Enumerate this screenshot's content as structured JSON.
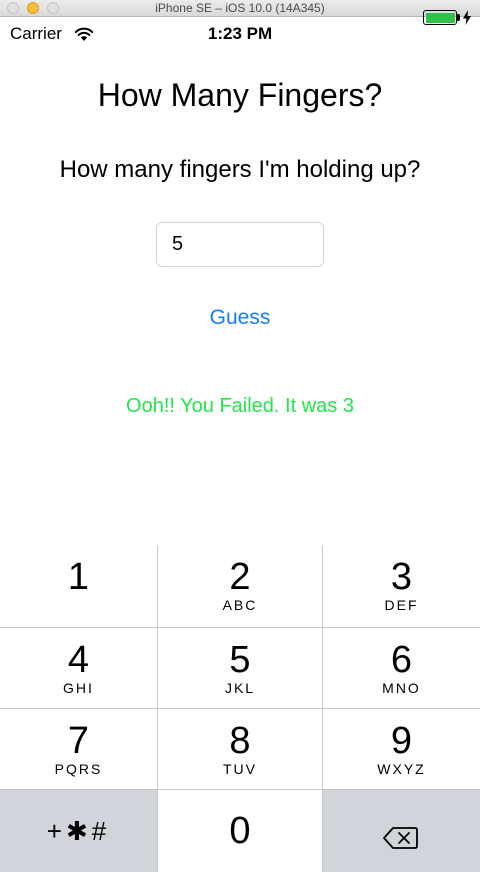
{
  "simulator": {
    "title": "iPhone SE – iOS 10.0 (14A345)"
  },
  "statusbar": {
    "carrier": "Carrier",
    "time": "1:23 PM",
    "battery_color": "#2ec24a"
  },
  "app": {
    "title": "How Many Fingers?",
    "question": "How many fingers I'm holding up?",
    "input_value": "5",
    "guess_label": "Guess",
    "result": "Ooh!! You Failed. It was 3",
    "accent_color": "#147efb",
    "result_color": "#22e64a"
  },
  "keypad": {
    "keys": [
      {
        "digit": "1",
        "letters": ""
      },
      {
        "digit": "2",
        "letters": "ABC"
      },
      {
        "digit": "3",
        "letters": "DEF"
      },
      {
        "digit": "4",
        "letters": "GHI"
      },
      {
        "digit": "5",
        "letters": "JKL"
      },
      {
        "digit": "6",
        "letters": "MNO"
      },
      {
        "digit": "7",
        "letters": "PQRS"
      },
      {
        "digit": "8",
        "letters": "TUV"
      },
      {
        "digit": "9",
        "letters": "WXYZ"
      }
    ],
    "symbols": "+✱#",
    "zero": "0",
    "backspace_icon": "delete-left-icon"
  }
}
